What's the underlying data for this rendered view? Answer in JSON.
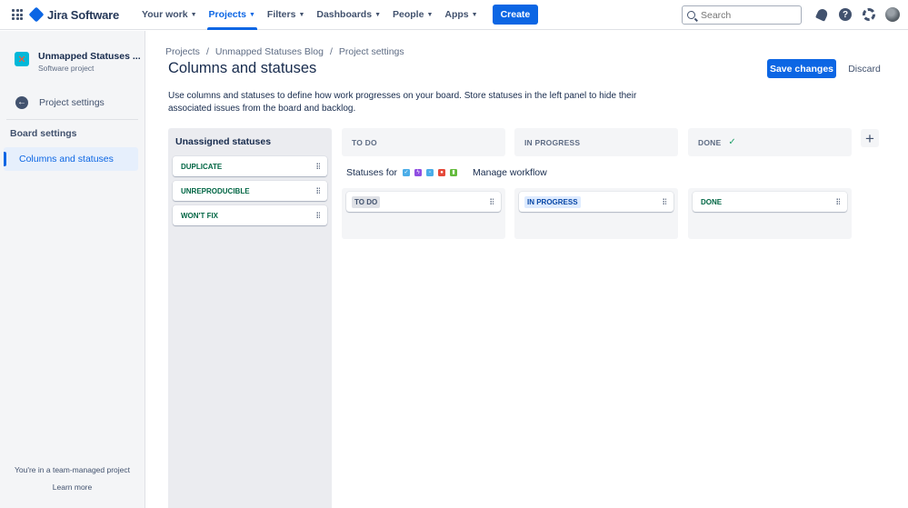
{
  "topnav": {
    "product_name": "Jira Software",
    "items": [
      {
        "label": "Your work"
      },
      {
        "label": "Projects",
        "active": true
      },
      {
        "label": "Filters"
      },
      {
        "label": "Dashboards"
      },
      {
        "label": "People"
      },
      {
        "label": "Apps"
      }
    ],
    "create_label": "Create",
    "search_placeholder": "Search",
    "help_glyph": "?"
  },
  "sidebar": {
    "project_name": "Unmapped Statuses ...",
    "project_type": "Software project",
    "back_label": "Project settings",
    "section_heading": "Board settings",
    "active_item": "Columns and statuses",
    "footer_text": "You're in a team-managed project",
    "footer_link": "Learn more"
  },
  "breadcrumb": [
    "Projects",
    "Unmapped Statuses Blog",
    "Project settings"
  ],
  "breadcrumb_sep": "/",
  "page": {
    "title": "Columns and statuses",
    "save_label": "Save changes",
    "discard_label": "Discard",
    "description": "Use columns and statuses to define how work progresses on your board. Store statuses in the left panel to hide their associated issues from the board and backlog."
  },
  "unassigned": {
    "title": "Unassigned statuses",
    "statuses": [
      "DUPLICATE",
      "UNREPRODUCIBLE",
      "WON'T FIX"
    ]
  },
  "columns": [
    {
      "name": "TO DO",
      "status": "TO DO",
      "status_color": "grey"
    },
    {
      "name": "IN PROGRESS",
      "status": "IN PROGRESS",
      "status_color": "blue"
    },
    {
      "name": "DONE",
      "status": "DONE",
      "status_color": "green",
      "done_check": "✓"
    }
  ],
  "workflow": {
    "statuses_for_label": "Statuses for",
    "issue_types": [
      {
        "icon": "task-icon",
        "color": "#4BADE8",
        "glyph": "✓"
      },
      {
        "icon": "epic-icon",
        "color": "#904EE2",
        "glyph": "ϟ"
      },
      {
        "icon": "subtask-icon",
        "color": "#4BADE8",
        "glyph": "▫"
      },
      {
        "icon": "bug-icon",
        "color": "#E5493A",
        "glyph": "●"
      },
      {
        "icon": "story-icon",
        "color": "#63BA3C",
        "glyph": "▮"
      }
    ],
    "manage_label": "Manage workflow"
  },
  "add_column_glyph": "+",
  "colors": {
    "accent": "#0C66E4",
    "sidebar_bg": "#F4F5F7",
    "panel_bg": "#EBECF0"
  }
}
